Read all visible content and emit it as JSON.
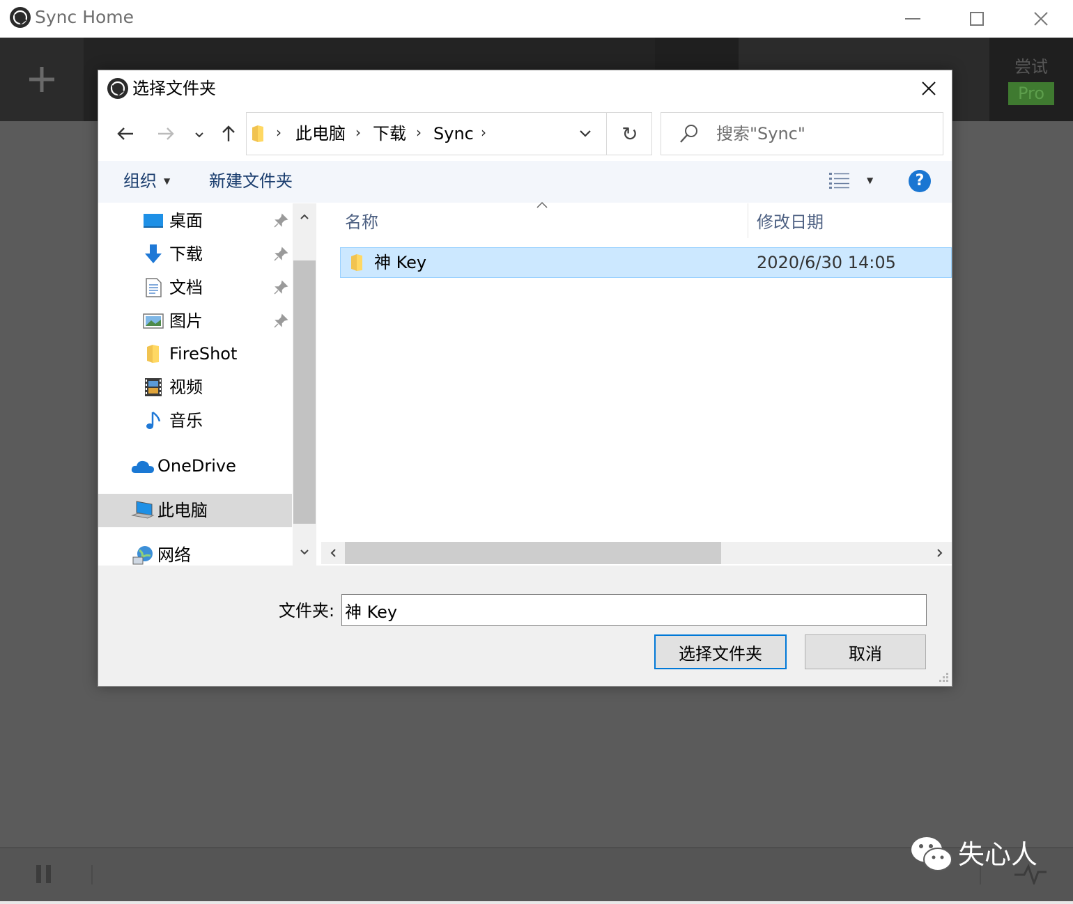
{
  "app": {
    "title": "Sync Home",
    "try_label": "尝试",
    "pro_label": "Pro",
    "icon": "sync-logo-icon"
  },
  "dialog": {
    "title": "选择文件夹",
    "breadcrumb": [
      "此电脑",
      "下载",
      "Sync"
    ],
    "search_placeholder": "搜索\"Sync\"",
    "organize_label": "组织",
    "new_folder_label": "新建文件夹",
    "help_label": "?",
    "nav_items": [
      {
        "label": "桌面",
        "icon": "desktop-icon",
        "pinned": true
      },
      {
        "label": "下载",
        "icon": "download-icon",
        "pinned": true
      },
      {
        "label": "文档",
        "icon": "document-icon",
        "pinned": true
      },
      {
        "label": "图片",
        "icon": "pictures-icon",
        "pinned": true
      },
      {
        "label": "FireShot",
        "icon": "folder-icon",
        "pinned": false
      },
      {
        "label": "视频",
        "icon": "video-icon",
        "pinned": false
      },
      {
        "label": "音乐",
        "icon": "music-icon",
        "pinned": false
      },
      {
        "label": "OneDrive",
        "icon": "onedrive-icon",
        "pinned": false
      },
      {
        "label": "此电脑",
        "icon": "this-pc-icon",
        "pinned": false,
        "selected": true
      },
      {
        "label": "网络",
        "icon": "network-icon",
        "pinned": false
      }
    ],
    "columns": {
      "name": "名称",
      "date": "修改日期"
    },
    "files": [
      {
        "name": "神 Key",
        "date": "2020/6/30 14:05",
        "selected": true
      }
    ],
    "folder_label": "文件夹:",
    "folder_value": "神 Key",
    "select_button": "选择文件夹",
    "cancel_button": "取消"
  },
  "watermark": {
    "text": "失心人",
    "icon": "wechat-icon"
  },
  "colors": {
    "accent": "#0078d7",
    "selection": "#cce8ff",
    "pro_green": "#3f7a30",
    "help_blue": "#1a76d2"
  }
}
